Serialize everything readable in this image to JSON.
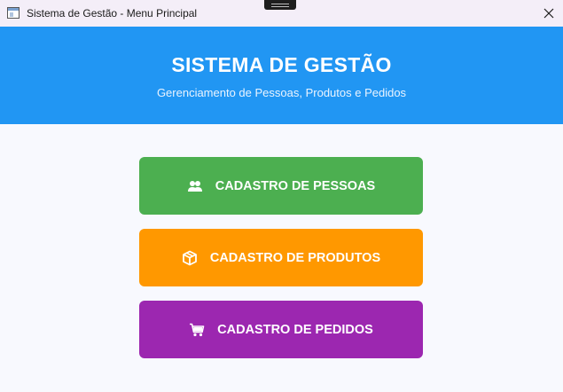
{
  "window": {
    "title": "Sistema de Gestão - Menu Principal"
  },
  "header": {
    "title": "SISTEMA DE GESTÃO",
    "subtitle": "Gerenciamento de Pessoas, Produtos e Pedidos"
  },
  "menu": {
    "buttons": [
      {
        "label": "CADASTRO DE PESSOAS",
        "icon": "people-icon",
        "color": "#4caf50"
      },
      {
        "label": "CADASTRO DE PRODUTOS",
        "icon": "box-icon",
        "color": "#ff9800"
      },
      {
        "label": "CADASTRO DE PEDIDOS",
        "icon": "shopping-cart-icon",
        "color": "#9c27b0"
      }
    ]
  },
  "colors": {
    "header": "#2196f3",
    "background": "#f8f9fe",
    "titlebar": "#f4eef8"
  }
}
